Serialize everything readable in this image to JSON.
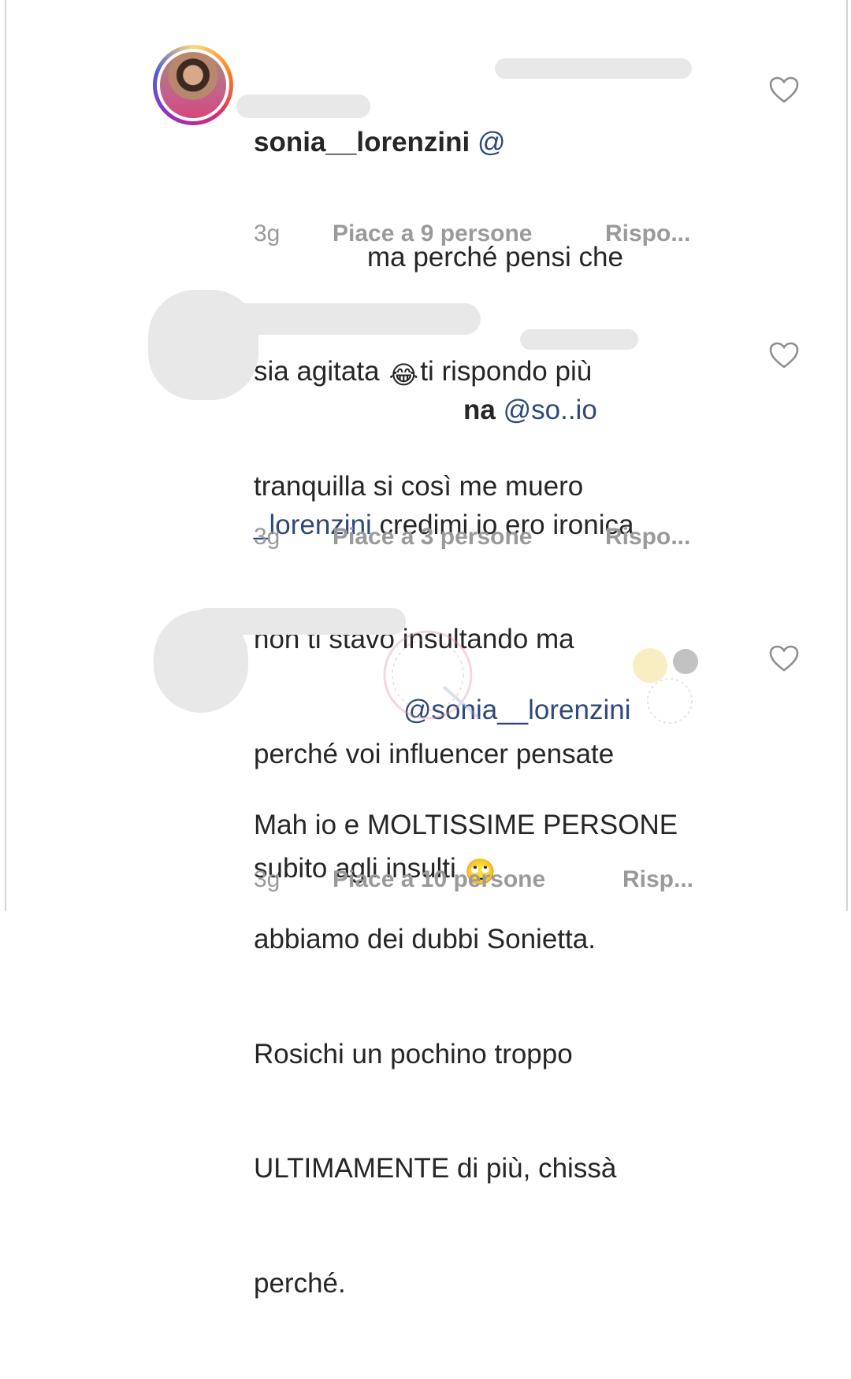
{
  "comments": [
    {
      "username": "sonia__lorenzini",
      "mention": "@",
      "body_line1": "ma perché pensi che",
      "body_line2a": "sia agitata ",
      "emoji": "😂",
      "body_line2b": "ti rispondo più",
      "body_line3": "tranquilla si così me muero",
      "time": "3g",
      "likes": "Piace a 9 persone",
      "reply": "Rispo..."
    },
    {
      "username_visible": "na",
      "mention_part1": "@so..io",
      "mention_part2": "_lorenzini",
      "body_line1": " credimi io ero ironica",
      "body_line2": "non ti stavo insultando ma",
      "body_line3": "perché voi influencer pensate",
      "body_line4": "subito agli insulti ",
      "emoji": "🙄",
      "time": "3g",
      "likes": "Piace a 3 persone",
      "reply": "Rispo..."
    },
    {
      "mention": "@sonia__lorenzini",
      "body_line1": "Mah io e MOLTISSIME PERSONE",
      "body_line2": "abbiamo dei dubbi Sonietta.",
      "body_line3": "Rosichi un pochino troppo",
      "body_line4": "ULTIMAMENTE di più, chissà",
      "body_line5": "perché.",
      "time": "3g",
      "likes": "Piace a 10 persone",
      "reply": "Risp..."
    }
  ],
  "icons": {
    "like": "heart-outline-icon"
  },
  "colors": {
    "text": "#262626",
    "meta": "#9a9a9a",
    "mention": "#2e4a7a"
  }
}
